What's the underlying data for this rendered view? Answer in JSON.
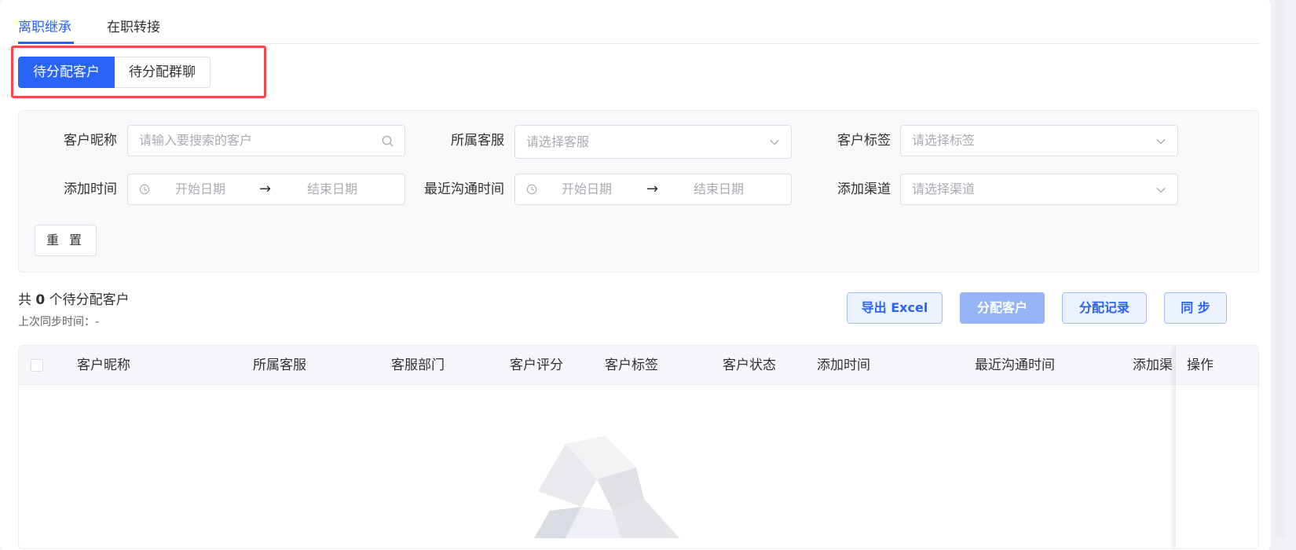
{
  "tabs": [
    {
      "label": "离职继承",
      "active": true
    },
    {
      "label": "在职转接",
      "active": false
    }
  ],
  "segment": {
    "options": [
      "待分配客户",
      "待分配群聊"
    ],
    "selected": "待分配客户"
  },
  "filters": {
    "nickname": {
      "label": "客户昵称",
      "placeholder": "请输入要搜索的客户",
      "icon": "search-icon"
    },
    "agent": {
      "label": "所属客服",
      "placeholder": "请选择客服",
      "icon": "chevron-down-icon"
    },
    "tags": {
      "label": "客户标签",
      "placeholder": "请选择标签",
      "icon": "chevron-down-icon"
    },
    "add_time": {
      "label": "添加时间",
      "start": "开始日期",
      "arrow": "→",
      "end": "结束日期",
      "icon": "clock-icon"
    },
    "last_contact": {
      "label": "最近沟通时间",
      "start": "开始日期",
      "arrow": "→",
      "end": "结束日期",
      "icon": "clock-icon"
    },
    "channel": {
      "label": "添加渠道",
      "placeholder": "请选择渠道",
      "icon": "chevron-down-icon"
    },
    "reset_label": "重 置"
  },
  "summary": {
    "prefix": "共",
    "count": "0",
    "suffix": "个待分配客户",
    "sync_label": "上次同步时间：-"
  },
  "actions": {
    "export": "导出 Excel",
    "assign": "分配客户",
    "records": "分配记录",
    "sync": "同 步"
  },
  "table": {
    "columns": [
      "客户昵称",
      "所属客服",
      "客服部门",
      "客户评分",
      "客户标签",
      "客户状态",
      "添加时间",
      "最近沟通时间",
      "添加渠"
    ],
    "fixed_column": "操作",
    "rows": []
  },
  "colors": {
    "primary": "#2a64f6",
    "highlight_border": "#f24a4a",
    "disabled_primary": "#96b4f5"
  }
}
